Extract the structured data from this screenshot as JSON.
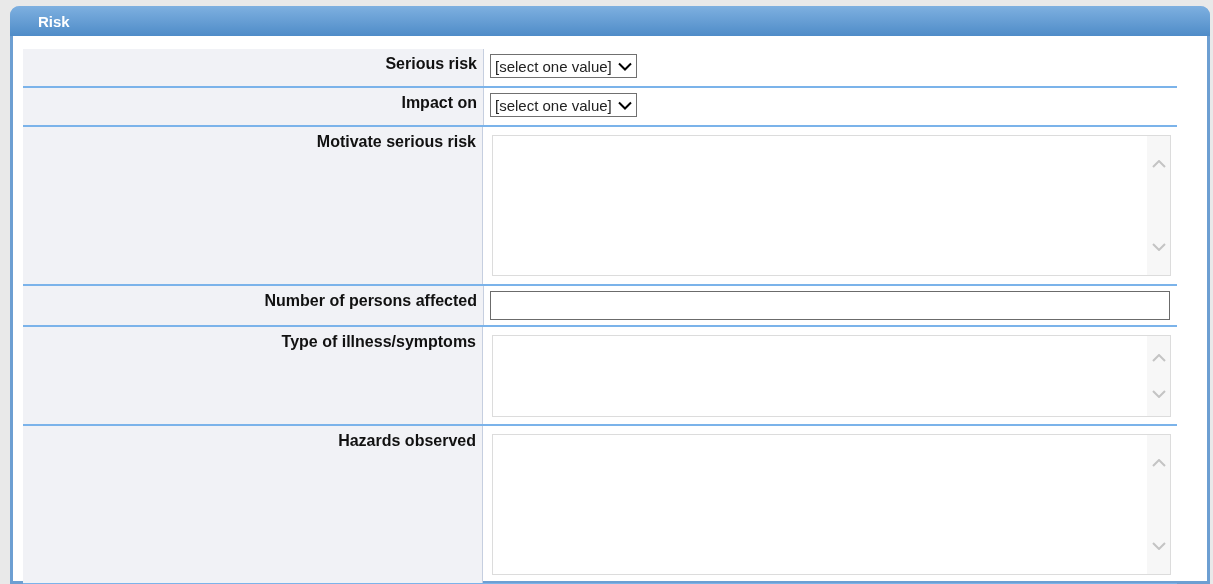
{
  "panel": {
    "title": "Risk"
  },
  "fields": [
    {
      "label": "Serious risk",
      "kind": "select",
      "value": "[select one value]"
    },
    {
      "label": "Impact on",
      "kind": "select",
      "value": "[select one value]"
    },
    {
      "label": "Motivate serious risk",
      "kind": "textarea"
    },
    {
      "label": "Number of persons affected",
      "kind": "text"
    },
    {
      "label": "Type of illness/symptoms",
      "kind": "memo"
    },
    {
      "label": "Hazards observed",
      "kind": "textarea"
    }
  ]
}
